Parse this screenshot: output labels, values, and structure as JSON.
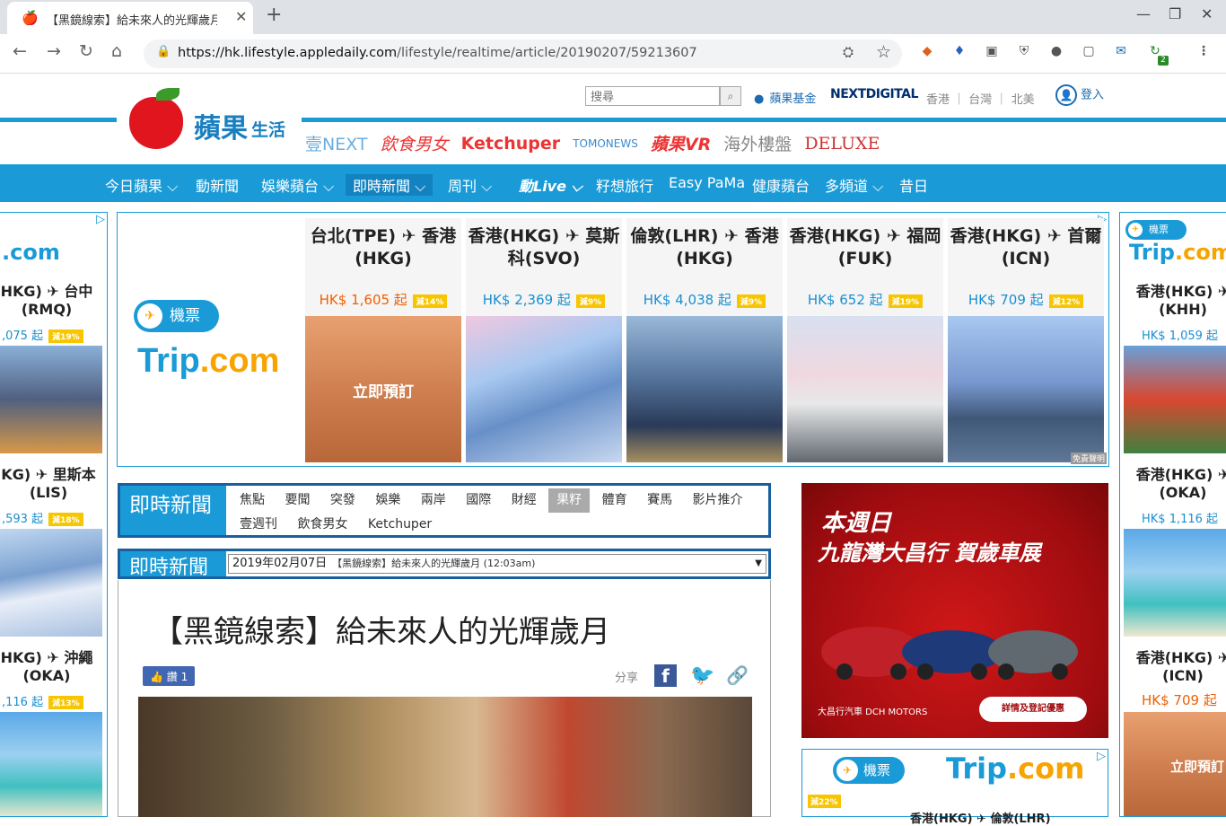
{
  "browser": {
    "tab_title": "【黑鏡線索】給未來人的光輝歲月",
    "url_host": "https://hk.lifestyle.appledaily.com",
    "url_path": "/lifestyle/realtime/article/20190207/59213607",
    "ext_badge": "2"
  },
  "header": {
    "logo_text": "蘋果",
    "logo_sub": "生活",
    "search_placeholder": "搜尋",
    "apple_fund": "蘋果基金",
    "next_digital": "NEXTDIGITAL",
    "regions": [
      "香港",
      "台灣",
      "北美"
    ],
    "login": "登入",
    "partners": [
      "壹NEXT",
      "飲食男女",
      "Ketchuper",
      "TOMONEWS",
      "蘋果VR",
      "海外樓盤",
      "DELUXE"
    ]
  },
  "nav": [
    "今日蘋果",
    "動新聞",
    "娛樂蘋台",
    "即時新聞",
    "周刊",
    "動Live",
    "籽想旅行",
    "Easy PaMa",
    "健康蘋台",
    "多頻道",
    "昔日"
  ],
  "main_ad": {
    "badge": "機票",
    "brand": "Trip",
    "brand_suffix": ".com",
    "flights": [
      {
        "route": "台北(TPE) ✈ 香港(HKG)",
        "price": "HK$ 1,605 起",
        "discount": "減14%",
        "button": "立即預訂"
      },
      {
        "route": "香港(HKG) ✈ 莫斯科(SVO)",
        "price": "HK$ 2,369 起",
        "discount": "減9%"
      },
      {
        "route": "倫敦(LHR) ✈ 香港(HKG)",
        "price": "HK$ 4,038 起",
        "discount": "減9%"
      },
      {
        "route": "香港(HKG) ✈ 福岡(FUK)",
        "price": "HK$ 652 起",
        "discount": "減19%"
      },
      {
        "route": "香港(HKG) ✈ 首爾(ICN)",
        "price": "HK$ 709 起",
        "discount": "減12%"
      }
    ],
    "disclaimer": "免責聲明"
  },
  "left_ad": {
    "brand": ".com",
    "flights": [
      {
        "route": "HKG) ✈ 台中 (RMQ)",
        "price": ",075 起",
        "discount": "減19%"
      },
      {
        "route": "KG) ✈ 里斯本 (LIS)",
        "price": ",593 起",
        "discount": "減18%"
      },
      {
        "route": "HKG) ✈ 沖繩 (OKA)",
        "price": ",116 起",
        "discount": "減13%"
      }
    ]
  },
  "right_ad": {
    "badge": "機票",
    "brand": "Trip",
    "brand_suffix": ".com",
    "flights": [
      {
        "route": "香港(HKG) ✈ (KHH)",
        "price": "HK$ 1,059 起"
      },
      {
        "route": "香港(HKG) ✈ (OKA)",
        "price": "HK$ 1,116 起"
      },
      {
        "route": "香港(HKG) ✈ (ICN)",
        "price": "HK$ 709 起"
      }
    ],
    "button": "立即預訂"
  },
  "category_box": {
    "label": "即時新聞",
    "links": [
      "焦點",
      "要聞",
      "突發",
      "娛樂",
      "兩岸",
      "國際",
      "財經",
      "果籽",
      "體育",
      "賽馬",
      "影片推介",
      "壹週刊",
      "飲食男女",
      "Ketchuper"
    ],
    "selected": "果籽"
  },
  "date_box": {
    "label": "即時新聞",
    "date": "2019年02月07日",
    "article_option": "【黑鏡線索】給未來人的光輝歲月 (12:03am)"
  },
  "article": {
    "title": "【黑鏡線索】給未來人的光輝歲月",
    "like_label": "讚 1",
    "share_label": "分享"
  },
  "car_ad": {
    "line1": "本週日",
    "line2": "九龍灣大昌行 賀歲車展",
    "brand": "大昌行汽車 DCH MOTORS",
    "button": "詳情及登記優惠"
  },
  "small_trip_ad": {
    "badge": "機票",
    "brand": "Trip",
    "brand_suffix": ".com",
    "discount": "減22%",
    "route": "香港(HKG) ✈ 倫敦(LHR)"
  }
}
